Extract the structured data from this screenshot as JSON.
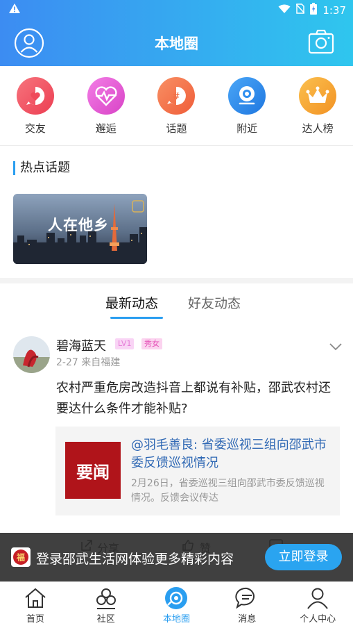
{
  "status_bar": {
    "time": "1:37"
  },
  "header": {
    "title": "本地圈"
  },
  "categories": [
    {
      "label": "交友",
      "icon": "heart-chat-icon",
      "color": "#f0505e"
    },
    {
      "label": "邂逅",
      "icon": "heartbeat-icon",
      "color": "#e14bd4"
    },
    {
      "label": "话题",
      "icon": "hashtag-icon",
      "color": "#f4734a"
    },
    {
      "label": "附近",
      "icon": "location-icon",
      "color": "#2f8ff0"
    },
    {
      "label": "达人榜",
      "icon": "crown-icon",
      "color": "#f5a22c"
    }
  ],
  "hot_topics": {
    "title": "热点话题",
    "cards": [
      {
        "text": "人在他乡"
      }
    ]
  },
  "feed_tabs": {
    "active": "最新动态",
    "inactive": "好友动态"
  },
  "post": {
    "username": "碧海蓝天",
    "level_badge": "LV1",
    "title_badge": "秀女",
    "meta": "2-27  来自福建",
    "content": "农村严重危房改造抖音上都说有补贴，邵武农村还要达什么条件才能补贴?",
    "news": {
      "thumb_text": "要闻",
      "title": "@羽毛善良: 省委巡视三组向邵武市委反馈巡视情况",
      "desc": "2月26日，省委巡视三组向邵武市委反馈巡视情况。反馈会议传达"
    },
    "actions": {
      "share": "分享",
      "like": "赞"
    }
  },
  "login_banner": {
    "text": "登录邵武生活网体验更多精彩内容",
    "button": "立即登录"
  },
  "bottom_nav": [
    {
      "label": "首页",
      "icon": "home-icon"
    },
    {
      "label": "社区",
      "icon": "community-icon"
    },
    {
      "label": "本地圈",
      "icon": "local-circle-icon",
      "active": true
    },
    {
      "label": "消息",
      "icon": "message-icon"
    },
    {
      "label": "个人中心",
      "icon": "person-icon"
    }
  ],
  "colors": {
    "accent": "#2a9ef0",
    "header_start": "#3c8cf2",
    "header_end": "#2fc6ee"
  }
}
